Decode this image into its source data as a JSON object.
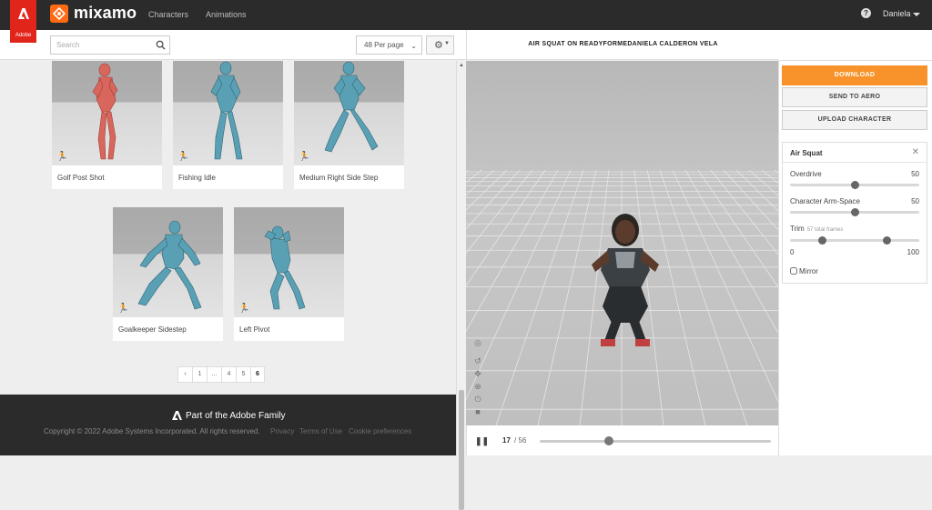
{
  "header": {
    "adobe_label": "Adobe",
    "logo": "mixamo",
    "nav": [
      "Characters",
      "Animations"
    ],
    "help_icon": "question-circle-icon",
    "user": "Daniela"
  },
  "toolbar": {
    "search_placeholder": "Search",
    "per_page": "48 Per page",
    "settings_icon": "gear-icon"
  },
  "cards": [
    {
      "label": "Golf Post Shot",
      "figure_color": "#d9665c"
    },
    {
      "label": "Fishing Idle",
      "figure_color": "#5aa0b4"
    },
    {
      "label": "Medium Right Side Step",
      "figure_color": "#5aa0b4"
    },
    {
      "label": "Goalkeeper Sidestep",
      "figure_color": "#5aa0b4"
    },
    {
      "label": "Left Pivot",
      "figure_color": "#5aa0b4"
    }
  ],
  "pagination": {
    "prev": "‹",
    "pages": [
      "1",
      "...",
      "4",
      "5",
      "6"
    ],
    "current": "6"
  },
  "footer": {
    "family": "Part of the Adobe Family",
    "copyright": "Copyright © 2022 Adobe Systems Incorporated. All rights reserved.",
    "links": [
      "Privacy",
      "Terms of Use",
      "Cookie preferences"
    ]
  },
  "viewer": {
    "title": "AIR SQUAT ON READYFORMEDANIELA CALDERON VELA",
    "frame_current": "17",
    "frame_total": "/ 56",
    "progress": 0.3
  },
  "actions": {
    "download": "DOWNLOAD",
    "send": "SEND TO AERO",
    "upload": "UPLOAD CHARACTER"
  },
  "settings": {
    "title": "Air Squat",
    "overdrive_label": "Overdrive",
    "overdrive_value": "50",
    "overdrive_pos": 0.5,
    "arm_label": "Character Arm-Space",
    "arm_value": "50",
    "arm_pos": 0.5,
    "trim_label": "Trim",
    "trim_sub": "57 total frames",
    "trim_min": "0",
    "trim_max": "100",
    "trim_start": 0.25,
    "trim_end": 0.75,
    "mirror_label": "Mirror"
  }
}
